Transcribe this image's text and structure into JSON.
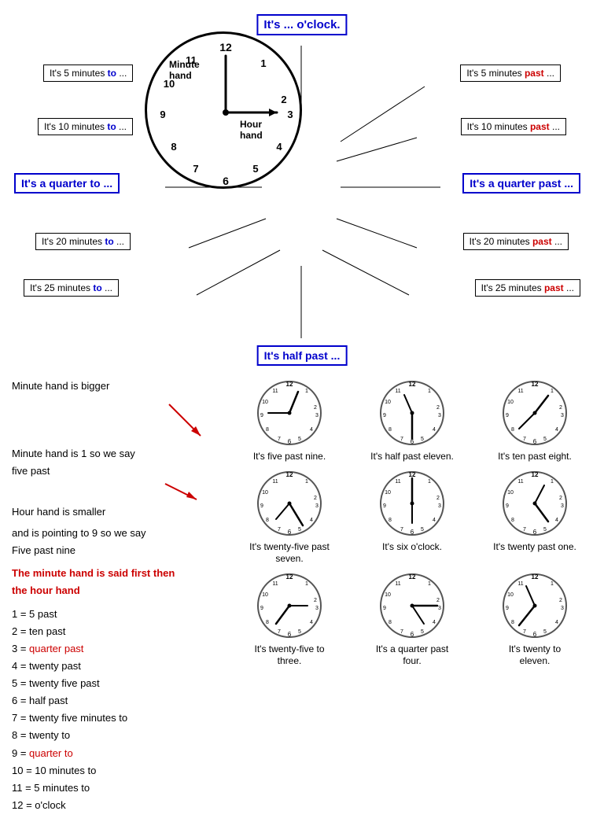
{
  "top_label": "It's ... o'clock.",
  "bottom_label": "It's half past ...",
  "quarter_past_label": "It's a quarter past ...",
  "quarter_to_label": "It's a quarter to ...",
  "labels_right": [
    "It's 5 minutes past ...",
    "It's 10 minutes past ...",
    "It's 20 minutes past ...",
    "It's 25 minutes past ..."
  ],
  "labels_left": [
    "It's 5 minutes to ...",
    "It's 10 minutes to ...",
    "It's 20 minutes to ...",
    "It's 25 minutes to ..."
  ],
  "hand_labels": {
    "minute": "Minute\nhand",
    "hour": "Hour\nhand"
  },
  "left_text": {
    "line1": "Minute hand is bigger",
    "line2": "Minute hand is 1 so we say",
    "line3": "five past",
    "line4": "Hour hand is smaller",
    "line5": "and is pointing to 9 so we say",
    "line6": "Five past nine",
    "note": "The minute hand is said first then\nthe hour hand",
    "list": [
      "1 = 5 past",
      "2 = ten past",
      "3 = quarter past",
      "4 = twenty past",
      "5 = twenty five past",
      "6 = half past",
      "7 = twenty five minutes to",
      "8 = twenty to",
      "9 = quarter to",
      "10 = 10 minutes to",
      "11 = 5 minutes to",
      "12 = o'clock"
    ],
    "list_red_indices": [
      2,
      8
    ]
  },
  "clock_rows": [
    [
      {
        "label": "It's five past nine.",
        "time": "five_past_nine"
      },
      {
        "label": "It's half past eleven.",
        "time": "half_past_eleven"
      },
      {
        "label": "It's ten past eight.",
        "time": "ten_past_eight"
      }
    ],
    [
      {
        "label": "It's twenty-five past seven.",
        "time": "twenty_five_past_seven"
      },
      {
        "label": "It's six o'clock.",
        "time": "six_oclock"
      },
      {
        "label": "It's twenty past one.",
        "time": "twenty_past_one"
      }
    ],
    [
      {
        "label": "It's twenty-five to three.",
        "time": "twenty_five_to_three"
      },
      {
        "label": "It's a quarter past four.",
        "time": "quarter_past_four"
      },
      {
        "label": "It's twenty to eleven.",
        "time": "twenty_to_eleven"
      }
    ]
  ]
}
